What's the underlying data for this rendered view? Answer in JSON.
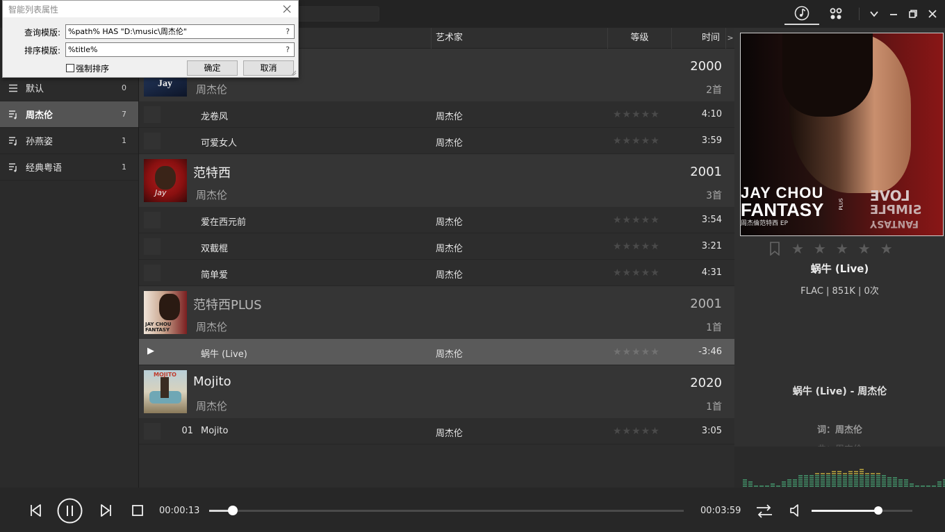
{
  "topbar": {
    "tab_nowplaying_icon": "music-note-icon",
    "tab_apps_icon": "apps-grid-icon"
  },
  "sidebar": {
    "items": [
      {
        "label": "默认",
        "count": "0",
        "icon": "list-icon",
        "active": false
      },
      {
        "label": "周杰伦",
        "count": "7",
        "icon": "smart-playlist-icon",
        "active": true
      },
      {
        "label": "孙燕姿",
        "count": "1",
        "icon": "smart-playlist-icon",
        "active": false
      },
      {
        "label": "经典粤语",
        "count": "1",
        "icon": "smart-playlist-icon",
        "active": false
      }
    ]
  },
  "columns": {
    "artist": "艺术家",
    "rating": "等级",
    "time": "时间",
    "more": ">"
  },
  "albums": [
    {
      "title": "",
      "artist": "周杰伦",
      "year": "2000",
      "count": "2首",
      "cover_text": "Jay",
      "tracks": [
        {
          "num": "",
          "name": "龙卷风",
          "artist": "周杰伦",
          "rating": "★★★★★",
          "time": "4:10"
        },
        {
          "num": "",
          "name": "可爱女人",
          "artist": "周杰伦",
          "rating": "★★★★★",
          "time": "3:59"
        }
      ]
    },
    {
      "title": "范特西",
      "artist": "周杰伦",
      "year": "2001",
      "count": "3首",
      "cover_text": "Jay",
      "tracks": [
        {
          "num": "",
          "name": "爱在西元前",
          "artist": "周杰伦",
          "rating": "★★★★★",
          "time": "3:54"
        },
        {
          "num": "",
          "name": "双截棍",
          "artist": "周杰伦",
          "rating": "★★★★★",
          "time": "3:21"
        },
        {
          "num": "",
          "name": "简单爱",
          "artist": "周杰伦",
          "rating": "★★★★★",
          "time": "4:31"
        }
      ]
    },
    {
      "title": "范特西PLUS",
      "artist": "周杰伦",
      "year": "2001",
      "count": "1首",
      "cover_text": "JAY CHOU FANTASY",
      "tracks": [
        {
          "num": "",
          "name": "蜗牛 (Live)",
          "artist": "周杰伦",
          "rating": "★★★★★",
          "time": "-3:46",
          "playing": true,
          "play_mark": "▶"
        }
      ]
    },
    {
      "title": "Mojito",
      "artist": "周杰伦",
      "year": "2020",
      "count": "1首",
      "cover_text": "MOJITO",
      "tracks": [
        {
          "num": "01",
          "name": "Mojito",
          "artist": "周杰伦",
          "rating": "★★★★★",
          "time": "3:05"
        }
      ]
    }
  ],
  "nowplaying": {
    "cover_line1": "JAY CHOU",
    "cover_line2": "FANTASY",
    "cover_plus": "PLUS",
    "cover_sub": "周杰倫范特西 EP",
    "cover_side1": "LOVE",
    "cover_side2": "SIMPLE",
    "cover_side3": "FANTASY",
    "stars": "★★★★★",
    "title": "蜗牛 (Live)",
    "info": "FLAC  | 851K | 0次",
    "lyric_title": "蜗牛 (Live)  - 周杰伦",
    "lyric_line": "词：周杰伦",
    "lyric_next": "曲：周杰伦",
    "spectrum_levels": [
      0.2,
      0.15,
      0.0,
      0.0,
      0.0,
      0.1,
      0.0,
      0.15,
      0.2,
      0.2,
      0.35,
      0.35,
      0.35,
      0.4,
      0.4,
      0.4,
      0.5,
      0.5,
      0.45,
      0.5,
      0.5,
      0.55,
      0.45,
      0.4,
      0.4,
      0.35,
      0.3,
      0.3,
      0.2,
      0.2,
      0.1,
      0.0,
      0.0,
      0.0,
      0.0,
      0.15,
      0.2
    ]
  },
  "player": {
    "time_current": "00:00:13",
    "time_total": "00:03:59",
    "progress": 0.05,
    "volume": 0.66
  },
  "dialog": {
    "title": "智能列表属性",
    "query_label": "查询模版:",
    "query_value": "%path% HAS \"D:\\music\\周杰伦\"",
    "sort_label": "排序模版:",
    "sort_value": "%title%",
    "help": "?",
    "force_sort_label": "强制排序",
    "ok": "确定",
    "cancel": "取消"
  },
  "colors": {
    "accent": "#d8d8d8",
    "panel": "#303030",
    "selected_row": "#5a5a5a",
    "spectrum_green": "#3e7f5e",
    "spectrum_yellow": "#9a8a3a"
  }
}
